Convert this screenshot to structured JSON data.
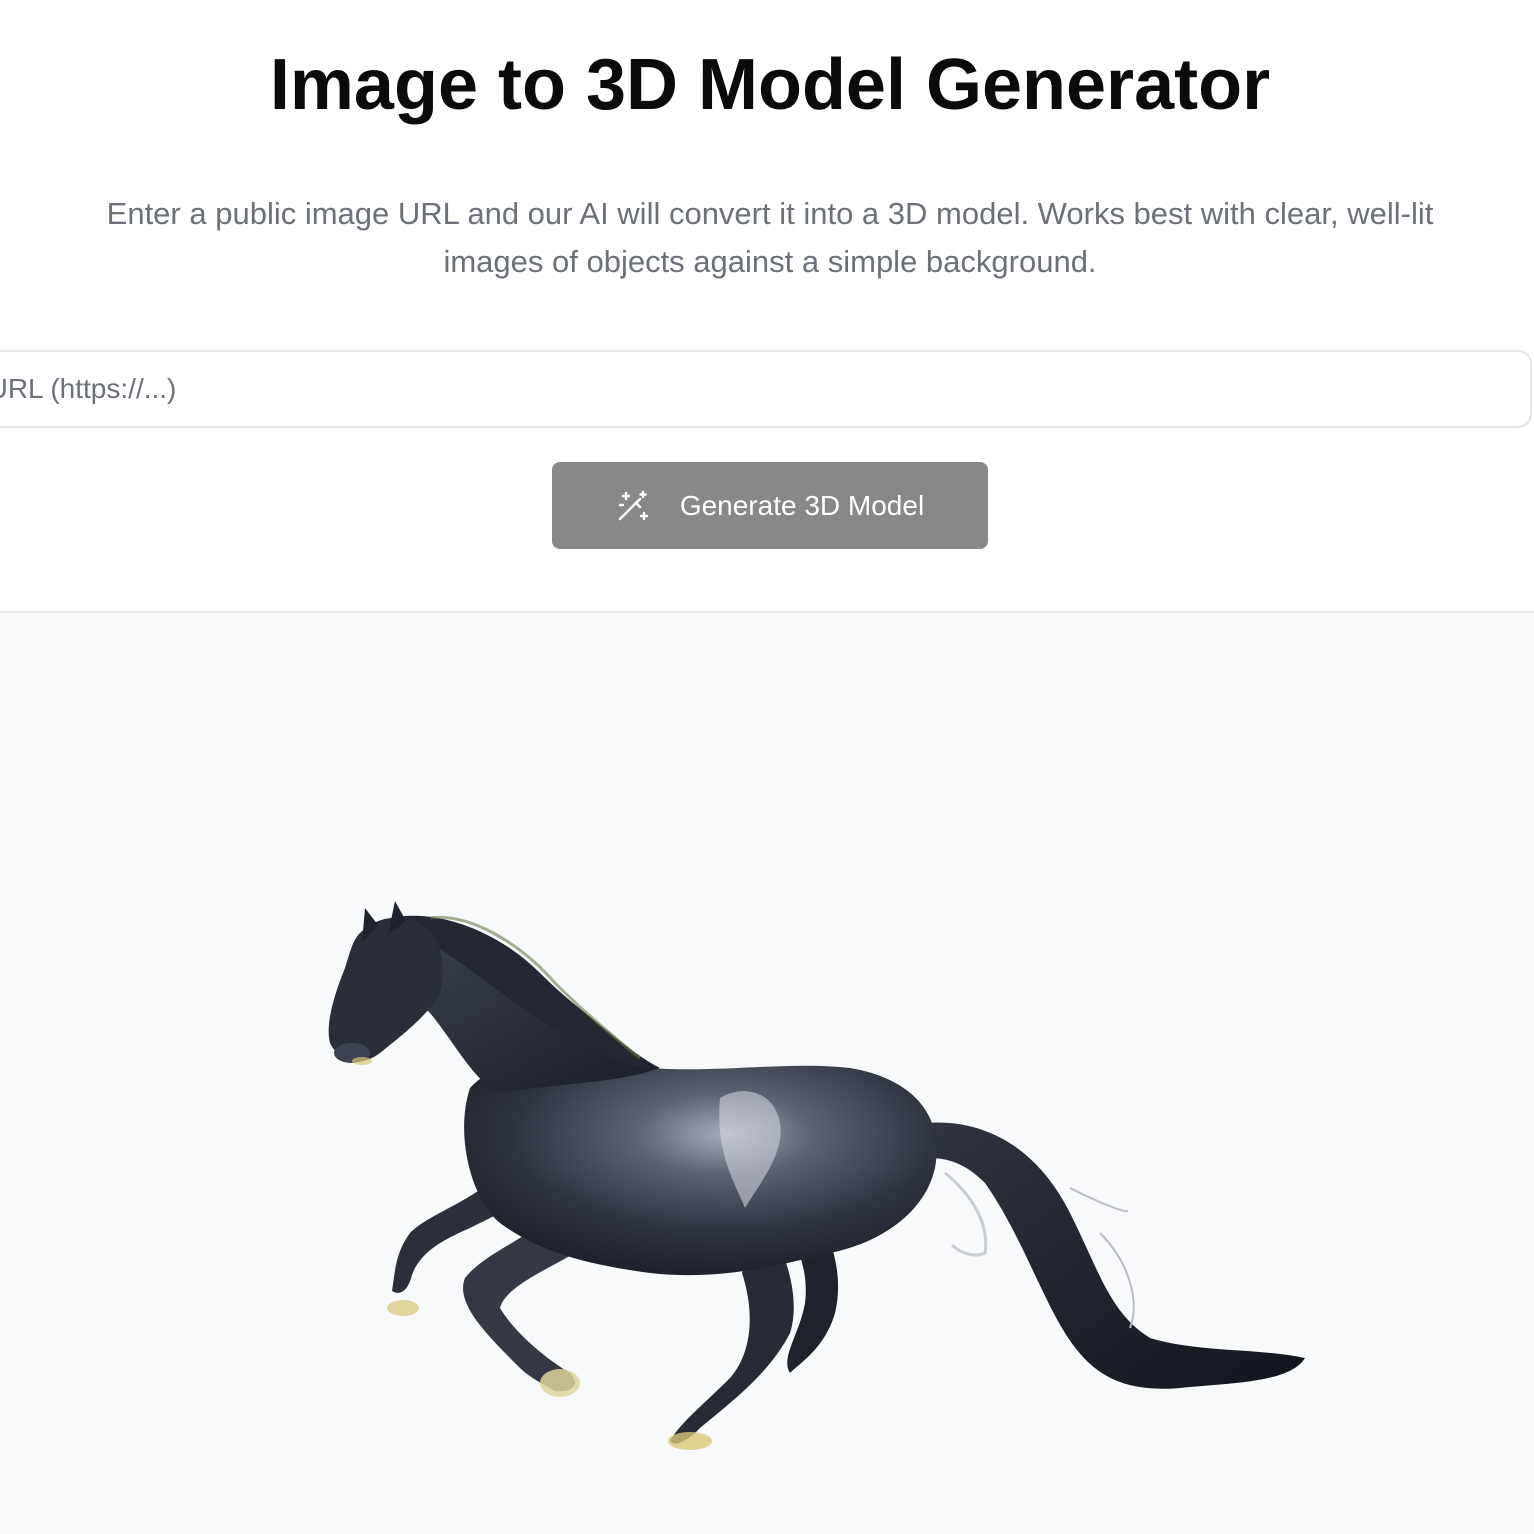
{
  "header": {
    "title": "Image to 3D Model Generator",
    "subtitle": "Enter a public image URL and our AI will convert it into a 3D model. Works best with clear, well-lit images of objects against a simple background."
  },
  "form": {
    "url_input": {
      "placeholder": "Image URL (https://...)",
      "value": ""
    },
    "generate_button": {
      "label": "Generate 3D Model",
      "icon": "magic-wand-icon",
      "state": "disabled",
      "color": "#888888"
    }
  },
  "viewer": {
    "background": "#f8f9fa",
    "model": "horse-3d-model"
  }
}
